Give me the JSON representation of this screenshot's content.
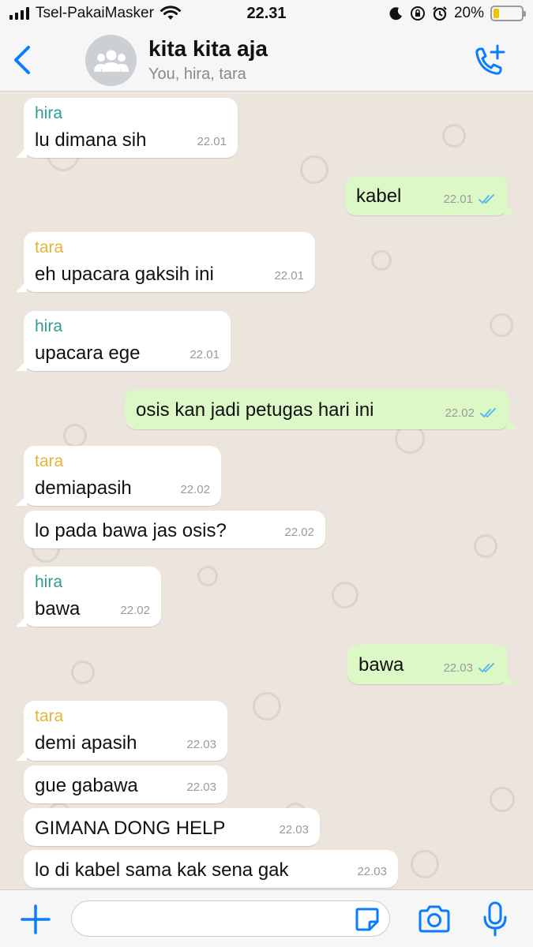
{
  "status_bar": {
    "carrier": "Tsel-PakaiMasker",
    "time": "22.31",
    "battery_percent": "20%",
    "battery_level": 0.2
  },
  "header": {
    "back_icon": "chevron-left-icon",
    "title": "kita kita aja",
    "subtitle": "You, hira, tara",
    "call_icon": "add-call-icon"
  },
  "colors": {
    "accent": "#0a7cff",
    "hira": "#2e9e8f",
    "tara": "#e2b53a",
    "outgoing_bubble": "#dcf8c6",
    "incoming_bubble": "#ffffff",
    "read_ticks": "#4fb6ec"
  },
  "messages": [
    {
      "dir": "in",
      "sender": "hira",
      "text": "lu dimana sih",
      "time": "22.01"
    },
    {
      "dir": "out",
      "text": "kabel",
      "time": "22.01",
      "read": true
    },
    {
      "dir": "in",
      "sender": "tara",
      "text": "eh upacara gaksih ini",
      "time": "22.01"
    },
    {
      "dir": "in",
      "sender": "hira",
      "text": "upacara ege",
      "time": "22.01"
    },
    {
      "dir": "out",
      "text": "osis kan jadi petugas hari ini",
      "time": "22.02",
      "read": true
    },
    {
      "dir": "in",
      "sender": "tara",
      "text": "demiapasih",
      "time": "22.02"
    },
    {
      "dir": "in",
      "text": "lo pada bawa jas osis?",
      "time": "22.02"
    },
    {
      "dir": "in",
      "sender": "hira",
      "text": "bawa",
      "time": "22.02"
    },
    {
      "dir": "out",
      "text": "bawa",
      "time": "22.03",
      "read": true
    },
    {
      "dir": "in",
      "sender": "tara",
      "text": "demi apasih",
      "time": "22.03"
    },
    {
      "dir": "in",
      "text": "gue gabawa",
      "time": "22.03"
    },
    {
      "dir": "in",
      "text": "GIMANA DONG HELP",
      "time": "22.03"
    },
    {
      "dir": "in",
      "text": "lo di kabel sama kak sena gak",
      "time": "22.03"
    }
  ],
  "input_bar": {
    "plus_icon": "plus-icon",
    "placeholder": "",
    "sticker_icon": "sticker-icon",
    "camera_icon": "camera-icon",
    "mic_icon": "microphone-icon"
  }
}
